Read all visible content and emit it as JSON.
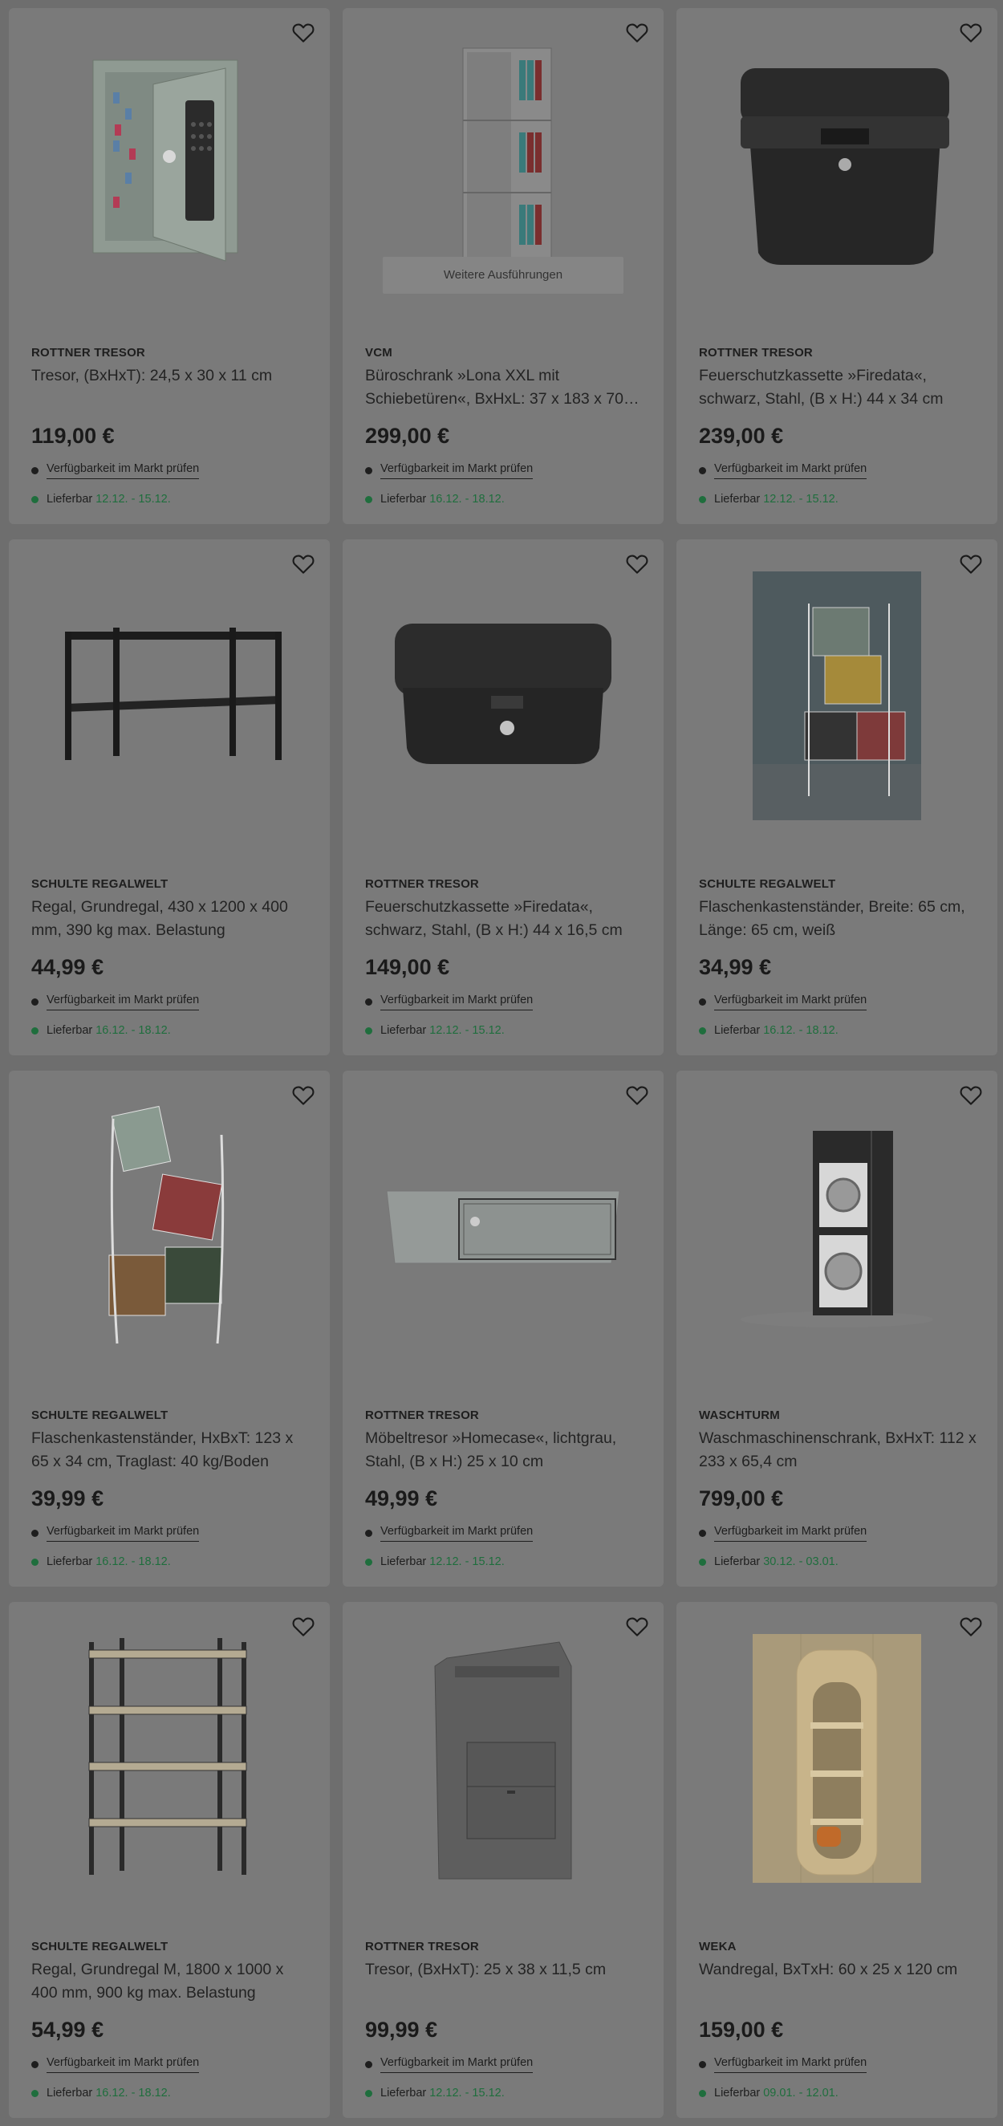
{
  "labels": {
    "availability": "Verfügbarkeit im Markt prüfen",
    "delivery": "Lieferbar",
    "more_variants": "Weitere Ausführungen"
  },
  "colors": {
    "overlay_background": "#6e6e6e",
    "card_background": "#7a7a7a",
    "delivery_green": "#1f6e3d"
  },
  "products": [
    {
      "brand": "ROTTNER TRESOR",
      "title": "Tresor, (BxHxT): 24,5 x 30 x 11 cm",
      "price": "119,00 €",
      "delivery": "12.12. - 15.12.",
      "image": "key-safe-image"
    },
    {
      "brand": "VCM",
      "title": "Büroschrank »Lona XXL mit Schiebetüren«, BxHxL: 37 x 183 x 70…",
      "price": "299,00 €",
      "delivery": "16.12. - 18.12.",
      "image": "office-cabinet-image",
      "variants": true
    },
    {
      "brand": "ROTTNER TRESOR",
      "title": "Feuerschutzkassette »Firedata«, schwarz, Stahl, (B x H:) 44 x 34 cm",
      "price": "239,00 €",
      "delivery": "12.12. - 15.12.",
      "image": "fire-box-large-image"
    },
    {
      "brand": "SCHULTE REGALWELT",
      "title": "Regal, Grundregal, 430 x 1200 x 400 mm, 390 kg max. Belastung",
      "price": "44,99 €",
      "delivery": "16.12. - 18.12.",
      "image": "low-shelf-image"
    },
    {
      "brand": "ROTTNER TRESOR",
      "title": "Feuerschutzkassette »Firedata«, schwarz, Stahl, (B x H:) 44 x 16,5 cm",
      "price": "149,00 €",
      "delivery": "12.12. - 15.12.",
      "image": "fire-box-flat-image"
    },
    {
      "brand": "SCHULTE REGALWELT",
      "title": "Flaschenkastenständer, Breite: 65 cm, Länge: 65 cm, weiß",
      "price": "34,99 €",
      "delivery": "16.12. - 18.12.",
      "image": "crate-stand-room-image"
    },
    {
      "brand": "SCHULTE REGALWELT",
      "title": "Flaschenkastenständer, HxBxT: 123 x 65 x 34 cm, Traglast: 40 kg/Boden",
      "price": "39,99 €",
      "delivery": "16.12. - 18.12.",
      "image": "crate-stand-image"
    },
    {
      "brand": "ROTTNER TRESOR",
      "title": "Möbeltresor »Homecase«, lichtgrau, Stahl, (B x H:) 25 x 10 cm",
      "price": "49,99 €",
      "delivery": "12.12. - 15.12.",
      "image": "furniture-safe-image"
    },
    {
      "brand": "WASCHTURM",
      "title": "Waschmaschinenschrank, BxHxT: 112 x 233 x 65,4 cm",
      "price": "799,00 €",
      "delivery": "30.12. - 03.01.",
      "image": "washer-cabinet-image"
    },
    {
      "brand": "SCHULTE REGALWELT",
      "title": "Regal, Grundregal M, 1800 x 1000 x 400 mm, 900 kg max. Belastung",
      "price": "54,99 €",
      "delivery": "16.12. - 18.12.",
      "image": "tall-shelf-image"
    },
    {
      "brand": "ROTTNER TRESOR",
      "title": "Tresor, (BxHxT): 25 x 38 x 11,5 cm",
      "price": "99,99 €",
      "delivery": "12.12. - 15.12.",
      "image": "mailbox-safe-image"
    },
    {
      "brand": "WEKA",
      "title": "Wandregal, BxTxH: 60 x 25 x 120 cm",
      "price": "159,00 €",
      "delivery": "09.01. - 12.01.",
      "image": "wall-shelf-image"
    }
  ]
}
